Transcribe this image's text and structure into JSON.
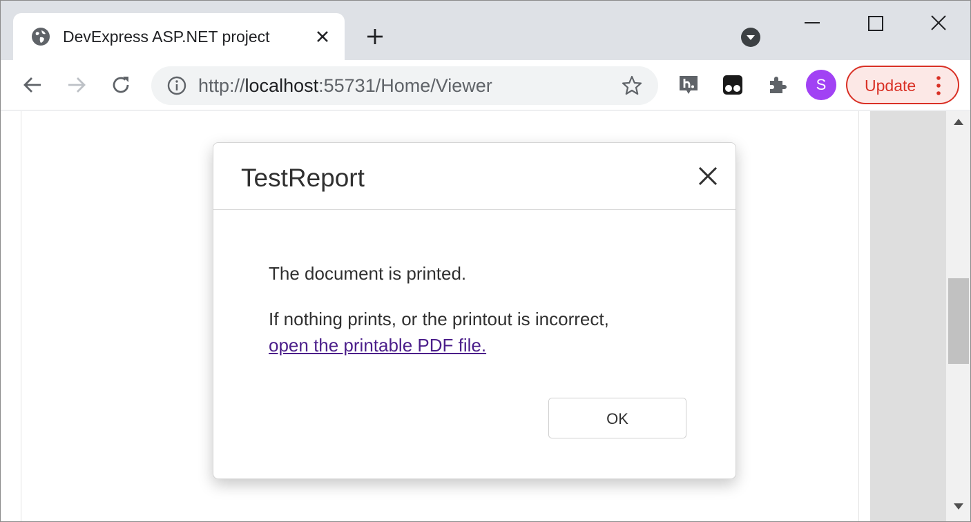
{
  "browser": {
    "tab": {
      "title": "DevExpress ASP.NET project",
      "favicon": "globe-icon"
    },
    "address_bar": {
      "scheme": "http://",
      "host": "localhost",
      "rest": ":55731/Home/Viewer"
    },
    "profile_initial": "S",
    "update_label": "Update",
    "colors": {
      "update_red": "#d93025",
      "avatar_purple": "#a142f4",
      "tab_strip": "#dee1e6"
    }
  },
  "dialog": {
    "title": "TestReport",
    "message_line1": "The document is printed.",
    "message_line2": "If nothing prints, or the printout is incorrect,",
    "link_text": "open the printable PDF file.",
    "ok_label": "OK",
    "colors": {
      "link": "#4b1e8a",
      "text": "#303030"
    }
  }
}
